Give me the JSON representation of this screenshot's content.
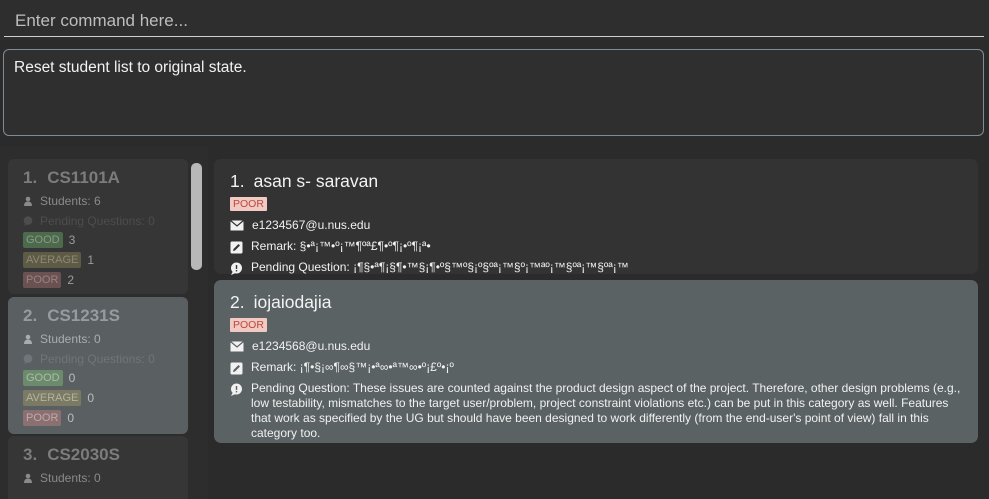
{
  "command_box": {
    "placeholder": "Enter command here..."
  },
  "result_box": {
    "text": "Reset student list to original state."
  },
  "classes": [
    {
      "index": "1.",
      "name": "CS1101A",
      "students": "Students: 6",
      "pending": "Pending Questions: 0",
      "good": "3",
      "average": "1",
      "poor": "2"
    },
    {
      "index": "2.",
      "name": "CS1231S",
      "students": "Students: 0",
      "pending": "Pending Questions: 0",
      "good": "0",
      "average": "0",
      "poor": "0"
    },
    {
      "index": "3.",
      "name": "CS2030S",
      "students": "Students: 0"
    }
  ],
  "tag_labels": {
    "good": "GOOD",
    "average": "AVERAGE",
    "poor": "POOR"
  },
  "students": [
    {
      "index": "1.",
      "name": "asan s- saravan",
      "tag": "POOR",
      "email": "e1234567@u.nus.edu",
      "remark": "Remark: §•ª¡™•º¡™¶ºª£¶•º¶¡•º¶¡ª•",
      "question": "Pending Question: ¡¶§•ª¶¡§¶•™§¡¶•º§™º§¡º§ºª¡™§º¡™ªº¡™§ºª¡™§ºª¡™"
    },
    {
      "index": "2.",
      "name": "iojaiodajia",
      "tag": "POOR",
      "email": "e1234568@u.nus.edu",
      "remark": "Remark: ¡¶•§¡∞¶∞§™¡•ª∞•ª™∞•º¡£º•¡º",
      "question": "Pending Question: These issues are counted against the product design aspect of the project. Therefore, other design problems (e.g., low testability, mismatches to the target user/problem, project constraint violations etc.) can be put in this category as well. Features that work as specified by the UG but should have been designed to work differently (from the end-user's point of view) fall in this category too."
    }
  ],
  "colors": {
    "poor_tag_bg": "#f2c9c3",
    "poor_tag_text": "#b84a3d",
    "selected_card": "#5b6264"
  },
  "icons": [
    "person-icon",
    "chat-bubble-icon",
    "mail-icon",
    "pencil-icon"
  ]
}
